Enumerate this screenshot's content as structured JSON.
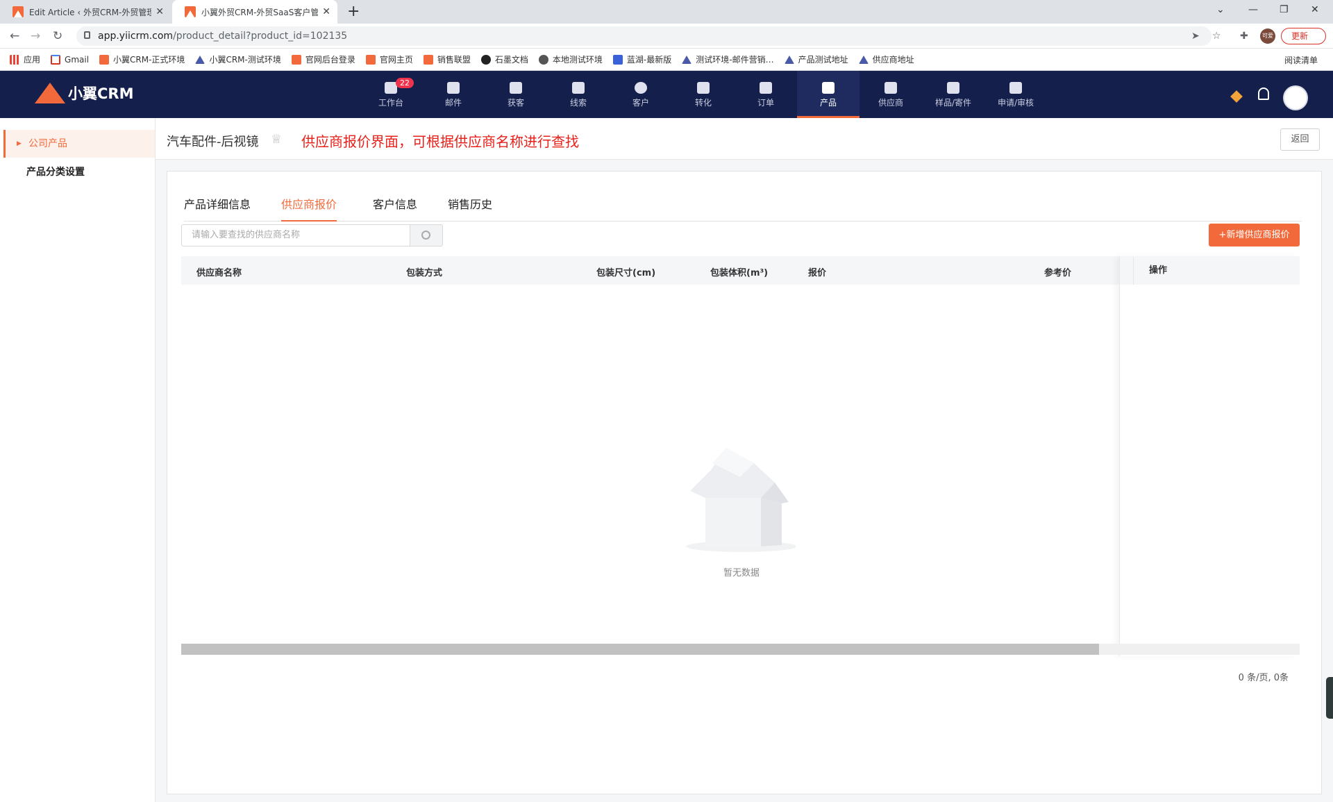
{
  "browser": {
    "tabs": [
      {
        "title": "Edit Article ‹ 外贸CRM-外贸管理…",
        "close": "✕"
      },
      {
        "title": "小翼外贸CRM-外贸SaaS客户管理…",
        "close": "✕"
      }
    ],
    "new_tab": "+",
    "window_controls": {
      "collapse": "⌄",
      "minimize": "—",
      "restore": "❐",
      "close": "✕"
    },
    "url_host": "app.yiicrm.com",
    "url_path": "/product_detail?product_id=102135",
    "profile_label": "可爱",
    "update_label": "更新",
    "reading_list": "阅读清单",
    "bookmarks": [
      {
        "label": "应用",
        "icon": "grid"
      },
      {
        "label": "Gmail",
        "icon": "g"
      },
      {
        "label": "小翼CRM-正式环境",
        "icon": "logo"
      },
      {
        "label": "小翼CRM-测试环境",
        "icon": "tri"
      },
      {
        "label": "官网后台登录",
        "icon": "logo"
      },
      {
        "label": "官网主页",
        "icon": "logo"
      },
      {
        "label": "销售联盟",
        "icon": "logo"
      },
      {
        "label": "石墨文档",
        "icon": "circ"
      },
      {
        "label": "本地测试环境",
        "icon": "glob"
      },
      {
        "label": "蓝湖-最新版",
        "icon": "blue"
      },
      {
        "label": "测试环境-邮件营销…",
        "icon": "tri"
      },
      {
        "label": "产品测试地址",
        "icon": "tri"
      },
      {
        "label": "供应商地址",
        "icon": "tri"
      }
    ]
  },
  "app": {
    "logo_text": "小翼CRM",
    "nav": [
      {
        "label": "工作台",
        "badge": "22"
      },
      {
        "label": "邮件"
      },
      {
        "label": "获客"
      },
      {
        "label": "线索"
      },
      {
        "label": "客户"
      },
      {
        "label": "转化"
      },
      {
        "label": "订单"
      },
      {
        "label": "产品",
        "active": true
      },
      {
        "label": "供应商"
      },
      {
        "label": "样品/寄件"
      },
      {
        "label": "申请/审核"
      }
    ]
  },
  "sidebar": {
    "items": [
      {
        "label": "公司产品",
        "active": true
      },
      {
        "label": "产品分类设置"
      }
    ]
  },
  "page": {
    "title": "汽车配件-后视镜",
    "annotation": "供应商报价界面，可根据供应商名称进行查找",
    "back_label": "返回",
    "tabs": [
      "产品详细信息",
      "供应商报价",
      "客户信息",
      "销售历史"
    ],
    "active_tab": "供应商报价",
    "search_placeholder": "请输入要查找的供应商名称",
    "add_button": "+新增供应商报价",
    "columns": [
      "供应商名称",
      "包装方式",
      "包装尺寸(cm)",
      "包装体积(m³)",
      "报价",
      "参考价",
      "操作"
    ],
    "rows": [],
    "empty_text": "暂无数据",
    "pagination": "0 条/页,  0条"
  }
}
